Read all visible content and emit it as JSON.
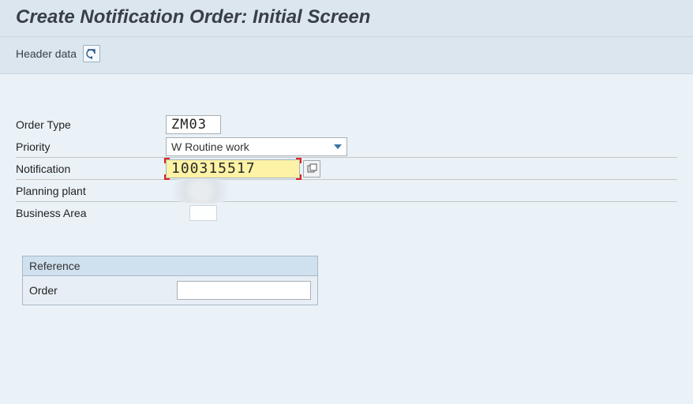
{
  "title": "Create Notification Order: Initial Screen",
  "toolbar": {
    "header_data_label": "Header data"
  },
  "fields": {
    "order_type": {
      "label": "Order Type",
      "value": "ZM03"
    },
    "priority": {
      "label": "Priority",
      "value": "W Routine work"
    },
    "notification": {
      "label": "Notification",
      "value": "100315517"
    },
    "planning_plant": {
      "label": "Planning plant",
      "value": ""
    },
    "business_area": {
      "label": "Business Area",
      "value": ""
    }
  },
  "reference": {
    "header": "Reference",
    "order_label": "Order",
    "order_value": ""
  }
}
